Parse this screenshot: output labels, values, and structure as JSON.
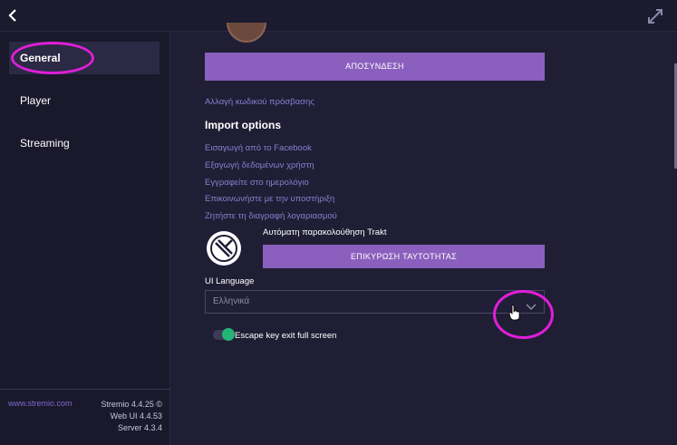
{
  "sidebar": {
    "items": [
      {
        "label": "General",
        "active": true
      },
      {
        "label": "Player",
        "active": false
      },
      {
        "label": "Streaming",
        "active": false
      }
    ],
    "footer_link": "www.stremio.com",
    "versions": [
      "Stremio 4.4.25 ©",
      "Web UI 4.4.53",
      "Server 4.3.4"
    ]
  },
  "main": {
    "logout_label": "ΑΠΟΣΥΝΔΕΣΗ",
    "change_password_link": "Αλλαγή κωδικού πρόσβασης",
    "import_title": "Import options",
    "links": [
      "Εισαγωγή από το Facebook",
      "Εξαγωγή δεδομένων χρήστη",
      "Εγγραφείτε στο ημερολόγιο",
      "Επικοινωνήστε με την υποστήριξη",
      "Ζητήστε τη διαγραφή λογαριασμού"
    ],
    "trakt_label": "Αυτόματη παρακολούθηση Trakt",
    "trakt_button": "ΕΠΙΚΥΡΩΣΗ ΤΑΥΤΟΤΗΤΑΣ",
    "ui_language_label": "UI Language",
    "ui_language_value": "Ελληνικά",
    "escape_label": "Escape key exit full screen",
    "escape_enabled": true
  },
  "colors": {
    "accent": "#8a5fbd",
    "annotation": "#e01ed8",
    "toggle_on": "#22b573"
  },
  "icons": {
    "back": "back-arrow-icon",
    "expand": "expand-icon",
    "trakt": "trakt-logo-icon",
    "chevron": "chevron-down-icon"
  }
}
